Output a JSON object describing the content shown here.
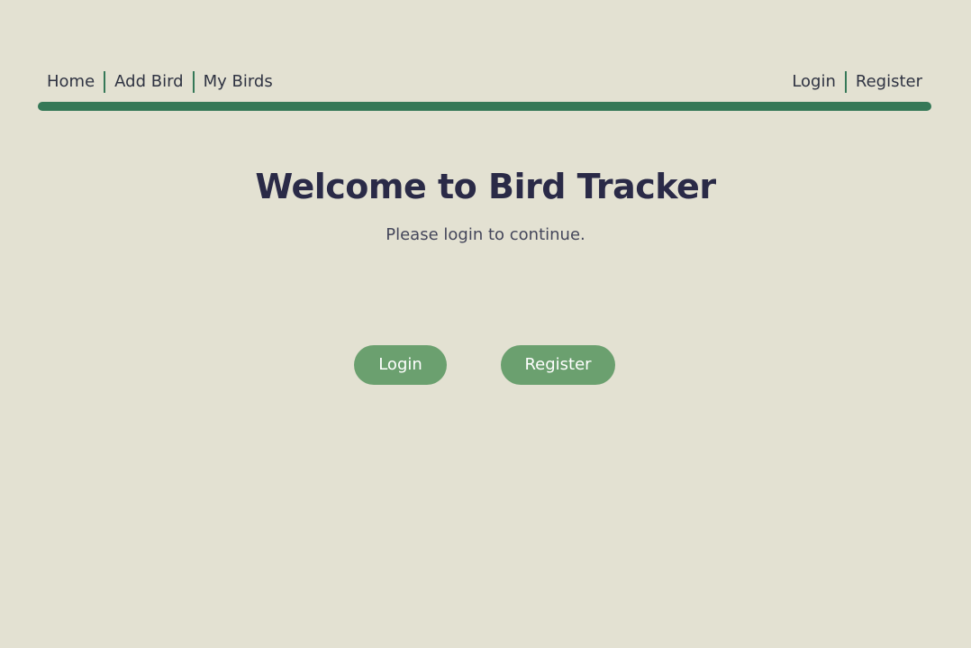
{
  "nav": {
    "left_links": [
      "Home",
      "Add Bird",
      "My Birds"
    ],
    "right_links": [
      "Login",
      "Register"
    ]
  },
  "hero": {
    "title": "Welcome to Bird Tracker",
    "subtitle": "Please login to continue."
  },
  "actions": {
    "login_label": "Login",
    "register_label": "Register"
  },
  "colors": {
    "background": "#e3e1d2",
    "accent": "#357857",
    "button": "#6ba06f",
    "title": "#2a2a47"
  }
}
